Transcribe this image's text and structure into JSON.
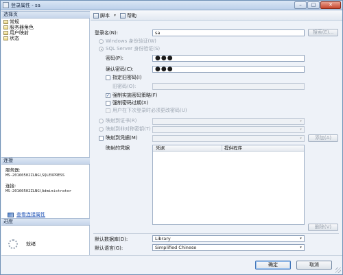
{
  "window": {
    "title": "登录属性 - sa",
    "min_glyph": "–",
    "max_glyph": "□",
    "close_glyph": "✕"
  },
  "left": {
    "select_page_header": "选择页",
    "pages": [
      {
        "label": "常规",
        "icon": "page-icon"
      },
      {
        "label": "服务器角色",
        "icon": "page-icon"
      },
      {
        "label": "用户映射",
        "icon": "page-icon"
      },
      {
        "label": "状态",
        "icon": "page-icon"
      }
    ],
    "connection_header": "连接",
    "server_label": "服务器:",
    "server_value": "MS-20160502ZLNG\\SQLEXPRESS",
    "connection_label": "连接:",
    "connection_value": "MS-20160502ZLNG\\Administrator",
    "view_props_link": "查看连接属性",
    "progress_header": "进度",
    "progress_status": "就绪"
  },
  "toolbar": {
    "script_label": "脚本",
    "dropdown_glyph": "▾",
    "help_label": "帮助"
  },
  "form": {
    "login_name_label": "登录名(N):",
    "login_name_value": "sa",
    "search_button": "搜索(E)...",
    "windows_auth_label": "Windows 身份验证(W)",
    "sql_auth_label": "SQL Server 身份验证(S)",
    "password_label": "密码(P):",
    "password_value": "●●●",
    "confirm_password_label": "确认密码(C):",
    "confirm_password_value": "●●●",
    "specify_old_password_label": "指定旧密码(I)",
    "old_password_label": "旧密码(O):",
    "enforce_policy_label": "强制实施密码策略(F)",
    "enforce_policy_checked": true,
    "enforce_expiration_label": "强制密码过期(X)",
    "must_change_label": "用户在下次登录时必须更改密码(U)",
    "cert_map_label": "映射到证书(R)",
    "asym_key_map_label": "映射到非对称密钥(T)",
    "map_credential_label": "映射到凭据(M)",
    "add_button": "添加(A)",
    "mapped_credentials_label": "映射的凭据",
    "grid_headers": [
      "凭据",
      "提供程序"
    ],
    "remove_button": "删除(V)",
    "default_db_label": "默认数据库(D):",
    "default_db_value": "Library",
    "default_lang_label": "默认语言(G):",
    "default_lang_value": "Simplified Chinese",
    "check_glyph": "✓"
  },
  "footer": {
    "ok_button": "确定",
    "cancel_button": "取消"
  }
}
